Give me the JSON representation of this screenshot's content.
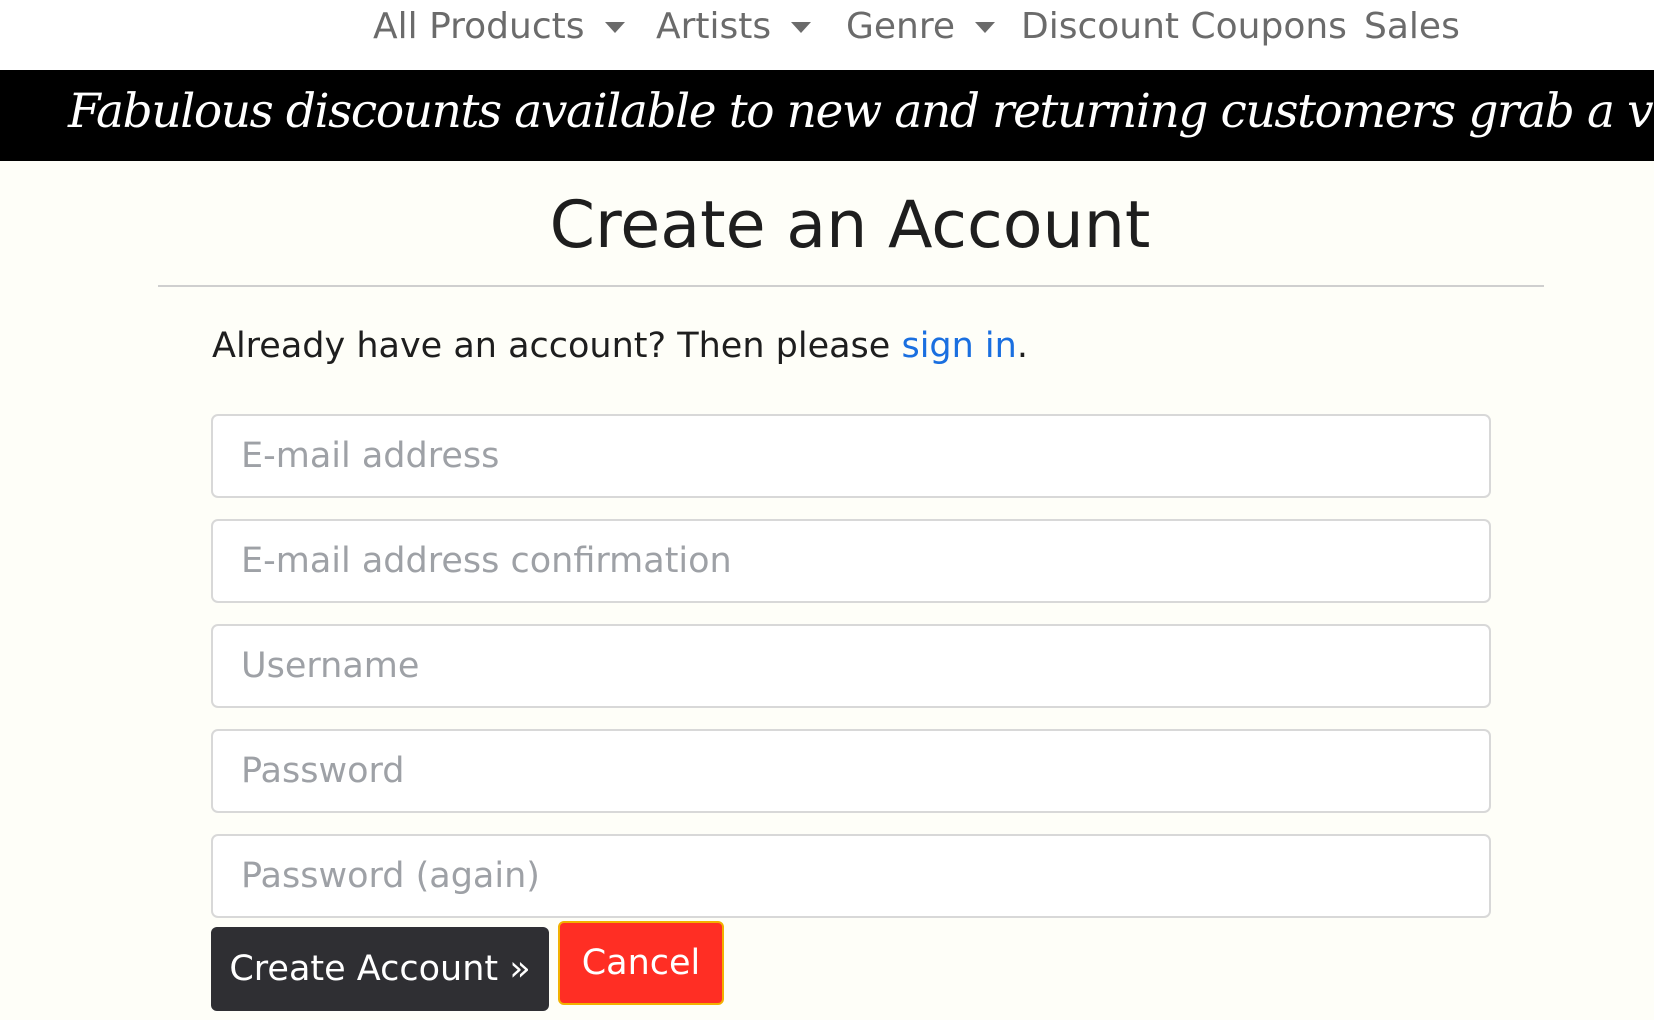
{
  "nav": {
    "all_products": "All Products",
    "artists": "Artists",
    "genre": "Genre",
    "discount_coupons": "Discount Coupons",
    "sales": "Sales"
  },
  "banner": {
    "text": "Fabulous discounts available to new and returning customers grab a voucher now!"
  },
  "page": {
    "title": "Create an Account",
    "signin_prefix": "Already have an account? Then please ",
    "signin_link": "sign in",
    "signin_suffix": "."
  },
  "form": {
    "email_placeholder": "E-mail address",
    "email_confirm_placeholder": "E-mail address confirmation",
    "username_placeholder": "Username",
    "password_placeholder": "Password",
    "password_again_placeholder": "Password (again)",
    "submit_label": "Create Account »",
    "cancel_label": "Cancel"
  },
  "colors": {
    "page_bg": "#fefef8",
    "banner_bg": "#000000",
    "link": "#1a6fe0",
    "submit_bg": "#2f2f33",
    "cancel_bg": "#ff2e24",
    "cancel_border": "#f2b100"
  }
}
